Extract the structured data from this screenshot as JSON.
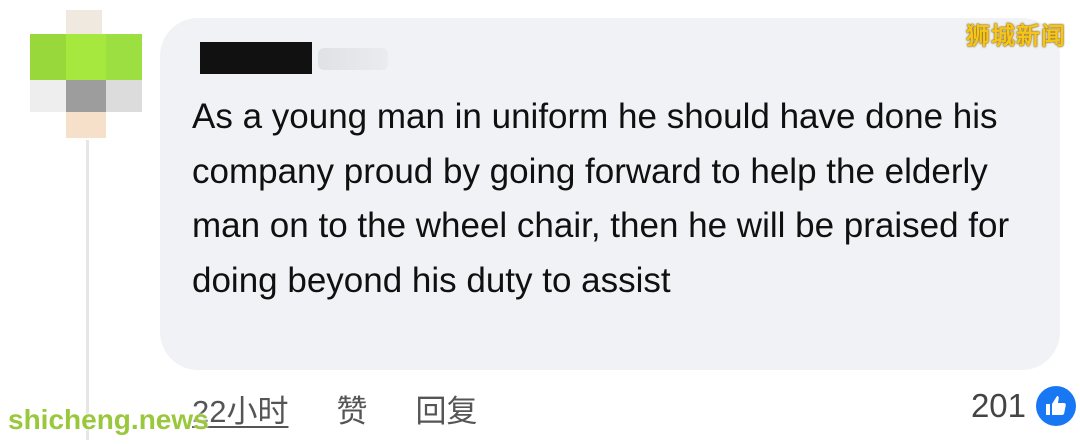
{
  "watermark": {
    "top_right": "狮城新闻",
    "bottom_left": "shicheng.news"
  },
  "comment": {
    "body": "As a young man in uniform he should have done his company proud by going forward to help the elderly man on to the wheel chair, then he will be praised for doing beyond his duty to assist",
    "time": "22小时",
    "like_label": "赞",
    "reply_label": "回复",
    "reaction_count": "201"
  },
  "colors": {
    "bubble_bg": "#f0f2f5",
    "like_blue": "#1877f2",
    "watermark_yellow": "#f7c51a",
    "watermark_green": "#9ac83c"
  },
  "icons": {
    "reaction": "thumbs-up-icon"
  }
}
